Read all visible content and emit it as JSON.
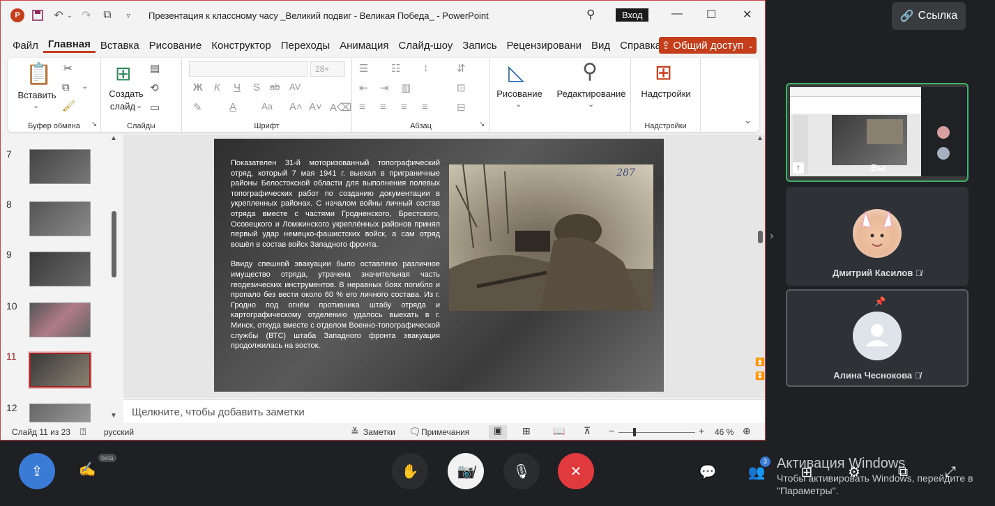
{
  "window": {
    "title": "Презентация к классному часу _Великий подвиг - Великая Победа_  -  PowerPoint",
    "login_label": "Вход"
  },
  "tabs": [
    "Файл",
    "Главная",
    "Вставка",
    "Рисование",
    "Конструктор",
    "Переходы",
    "Анимация",
    "Слайд-шоу",
    "Запись",
    "Рецензировани",
    "Вид",
    "Справка"
  ],
  "share_label": "Общий доступ",
  "ribbon": {
    "insert_label": "Вставить",
    "clipboard_group": "Буфер обмена",
    "new_slide_label_1": "Создать",
    "new_slide_label_2": "слайд",
    "slides_group": "Слайды",
    "font_size_placeholder": "28+",
    "font_group": "Шрифт",
    "bold": "Ж",
    "italic": "К",
    "underline": "Ч",
    "strike_s": "S",
    "strike_ab": "ab",
    "spacing": "AV",
    "case": "Aa",
    "paragraph_group": "Абзац",
    "drawing_label": "Рисование",
    "editing_label": "Редактирование",
    "addins_label": "Надстройки",
    "addins_group": "Надстройки"
  },
  "thumbnails": [
    {
      "num": "7"
    },
    {
      "num": "8"
    },
    {
      "num": "9"
    },
    {
      "num": "10"
    },
    {
      "num": "11"
    },
    {
      "num": "12"
    }
  ],
  "slide": {
    "paragraph1": "Показателен 31-й моторизованный топографический отряд, который 7 мая 1941 г. выехал в приграничные районы Белостокской области для выполнения полевых топографических работ по созданию документации в укрепленных районах. С началом войны личный состав отряда вместе с частями Гродненского, Брестского, Осовецкого и Ломжинского укреплённых районов принял первый удар немецко-фашистских войск, а сам отряд вошёл в состав войск Западного фронта.",
    "paragraph2": "Ввиду спешной эвакуации было оставлено различное имущество отряда, утрачена значительная часть геодезических инструментов. В неравных боях погибло и пропало без вести около 60 % его личного состава. Из г. Гродно под огнём противника штабу отряда и картографическому отделению удалось выехать в г. Минск, откуда вместе с отделом Военно-топографической службы (ВТС) штаба Западного фронта эвакуация продолжилась на восток.",
    "photo_number": "287"
  },
  "notes_placeholder": "Щелкните, чтобы добавить заметки",
  "status": {
    "slide_info": "Слайд 11 из 23",
    "language": "русский",
    "notes_label": "Заметки",
    "comments_label": "Примечания",
    "zoom": "46 %"
  },
  "call": {
    "link_label": "Ссылка",
    "screen_you_label": "Вы",
    "participant1": "Дмитрий Касилов",
    "participant2": "Алина Чеснокова",
    "beta_label": "beta",
    "people_count": "3"
  },
  "activation": {
    "title": "Активация Windows",
    "line1": "Чтобы активировать Windows, перейдите в",
    "line2": "\"Параметры\"."
  },
  "colors": {
    "accent": "#c43e1c",
    "end_call": "#e0393e",
    "share_screen": "#3a7bd5"
  }
}
